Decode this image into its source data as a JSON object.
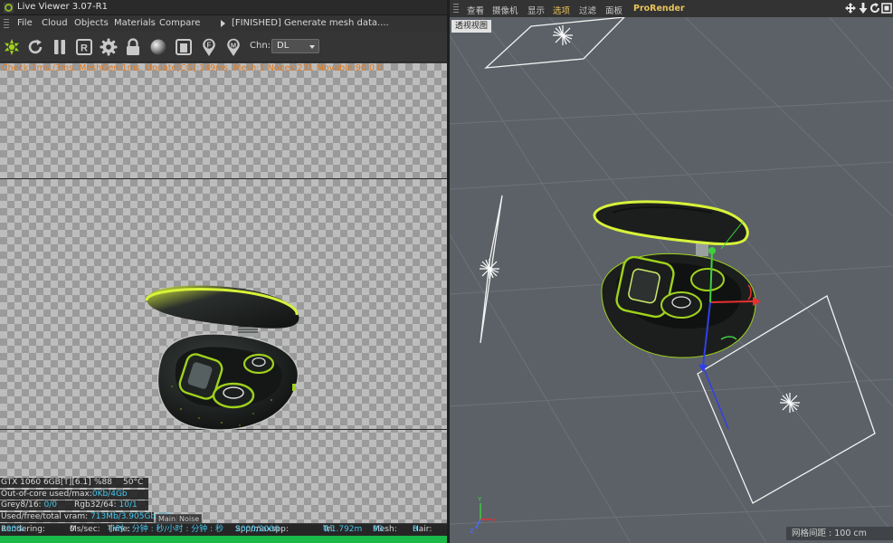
{
  "live_viewer": {
    "title": "Live Viewer 3.07-R1",
    "menu": [
      "File",
      "Cloud",
      "Objects",
      "Materials",
      "Compare"
    ],
    "status": "[FINISHED] Generate mesh data....",
    "toolbar_icons": [
      "octane-logo-icon",
      "refresh-icon",
      "pause-icon",
      "region-render-icon",
      "settings-gear-icon",
      "lock-icon",
      "material-ball-icon",
      "clay-mode-icon",
      "focus-pick-icon",
      "material-pick-icon"
    ],
    "region_letter": "R",
    "focus_letter": "F",
    "material_letter": "M",
    "channel_label": "Chn:",
    "channel_value": "DL",
    "stats_line": "Check:1ms./3ms. MeshGen:1ms. Update[CG]:149ms. Mesh:1 Nodes:231 Movable:90  0  0",
    "gpu": {
      "name": "GTX 1060 6GB[T][6.1]",
      "usage": "%88",
      "temp": "50°C"
    },
    "out_of_core_label": "Out-of-core used/max:",
    "out_of_core_value": "0Kb/4Gb",
    "grey_label": "Grey8/16:",
    "grey_value": "0/0",
    "rgb_label": "Rgb32/64:",
    "rgb_value": "10/1",
    "vram_label": "Used/free/total vram:",
    "vram_value": "713Mb/3.905Gb/6Gb",
    "tabs": [
      "Main",
      "Noise"
    ],
    "bottom": {
      "rendering_label": "Rendering:",
      "rendering_value": "100%",
      "ms_label": "Ms/sec:",
      "ms_value": "0",
      "time_label": "Time:",
      "time_value": "小时 : 分钟 : 秒/小时 : 分钟 : 秒",
      "spp_label": "Spp/maxspp:",
      "spp_value": "2000/2000",
      "tri_label": "Tri:",
      "tri_value": "0/1.792m",
      "mesh_label": "Mesh:",
      "mesh_value": "93",
      "hair_label": "Hair:",
      "hair_value": "0"
    },
    "progress": 100,
    "colors": {
      "stats": "#e07a1f",
      "highlight": "#45c8f0",
      "progress": "#1bb84a",
      "accent_green": "#9fd21c"
    }
  },
  "viewport": {
    "menu": [
      "查看",
      "摄像机",
      "显示",
      "选项",
      "过滤",
      "面板"
    ],
    "active_menu": "选项",
    "renderer_menu": "ProRender",
    "nav_icons": [
      "move-view-icon",
      "zoom-view-icon",
      "rotate-view-icon",
      "toggle-view-icon"
    ],
    "view_label": "透视视图",
    "grid_spacing": "网格间距 : 100 cm",
    "axis_labels": {
      "x": "X",
      "y": "Y",
      "z": "Z"
    },
    "colors": {
      "background": "#5b6167",
      "active": "#e8c35a",
      "grid": "#6c7278"
    }
  }
}
